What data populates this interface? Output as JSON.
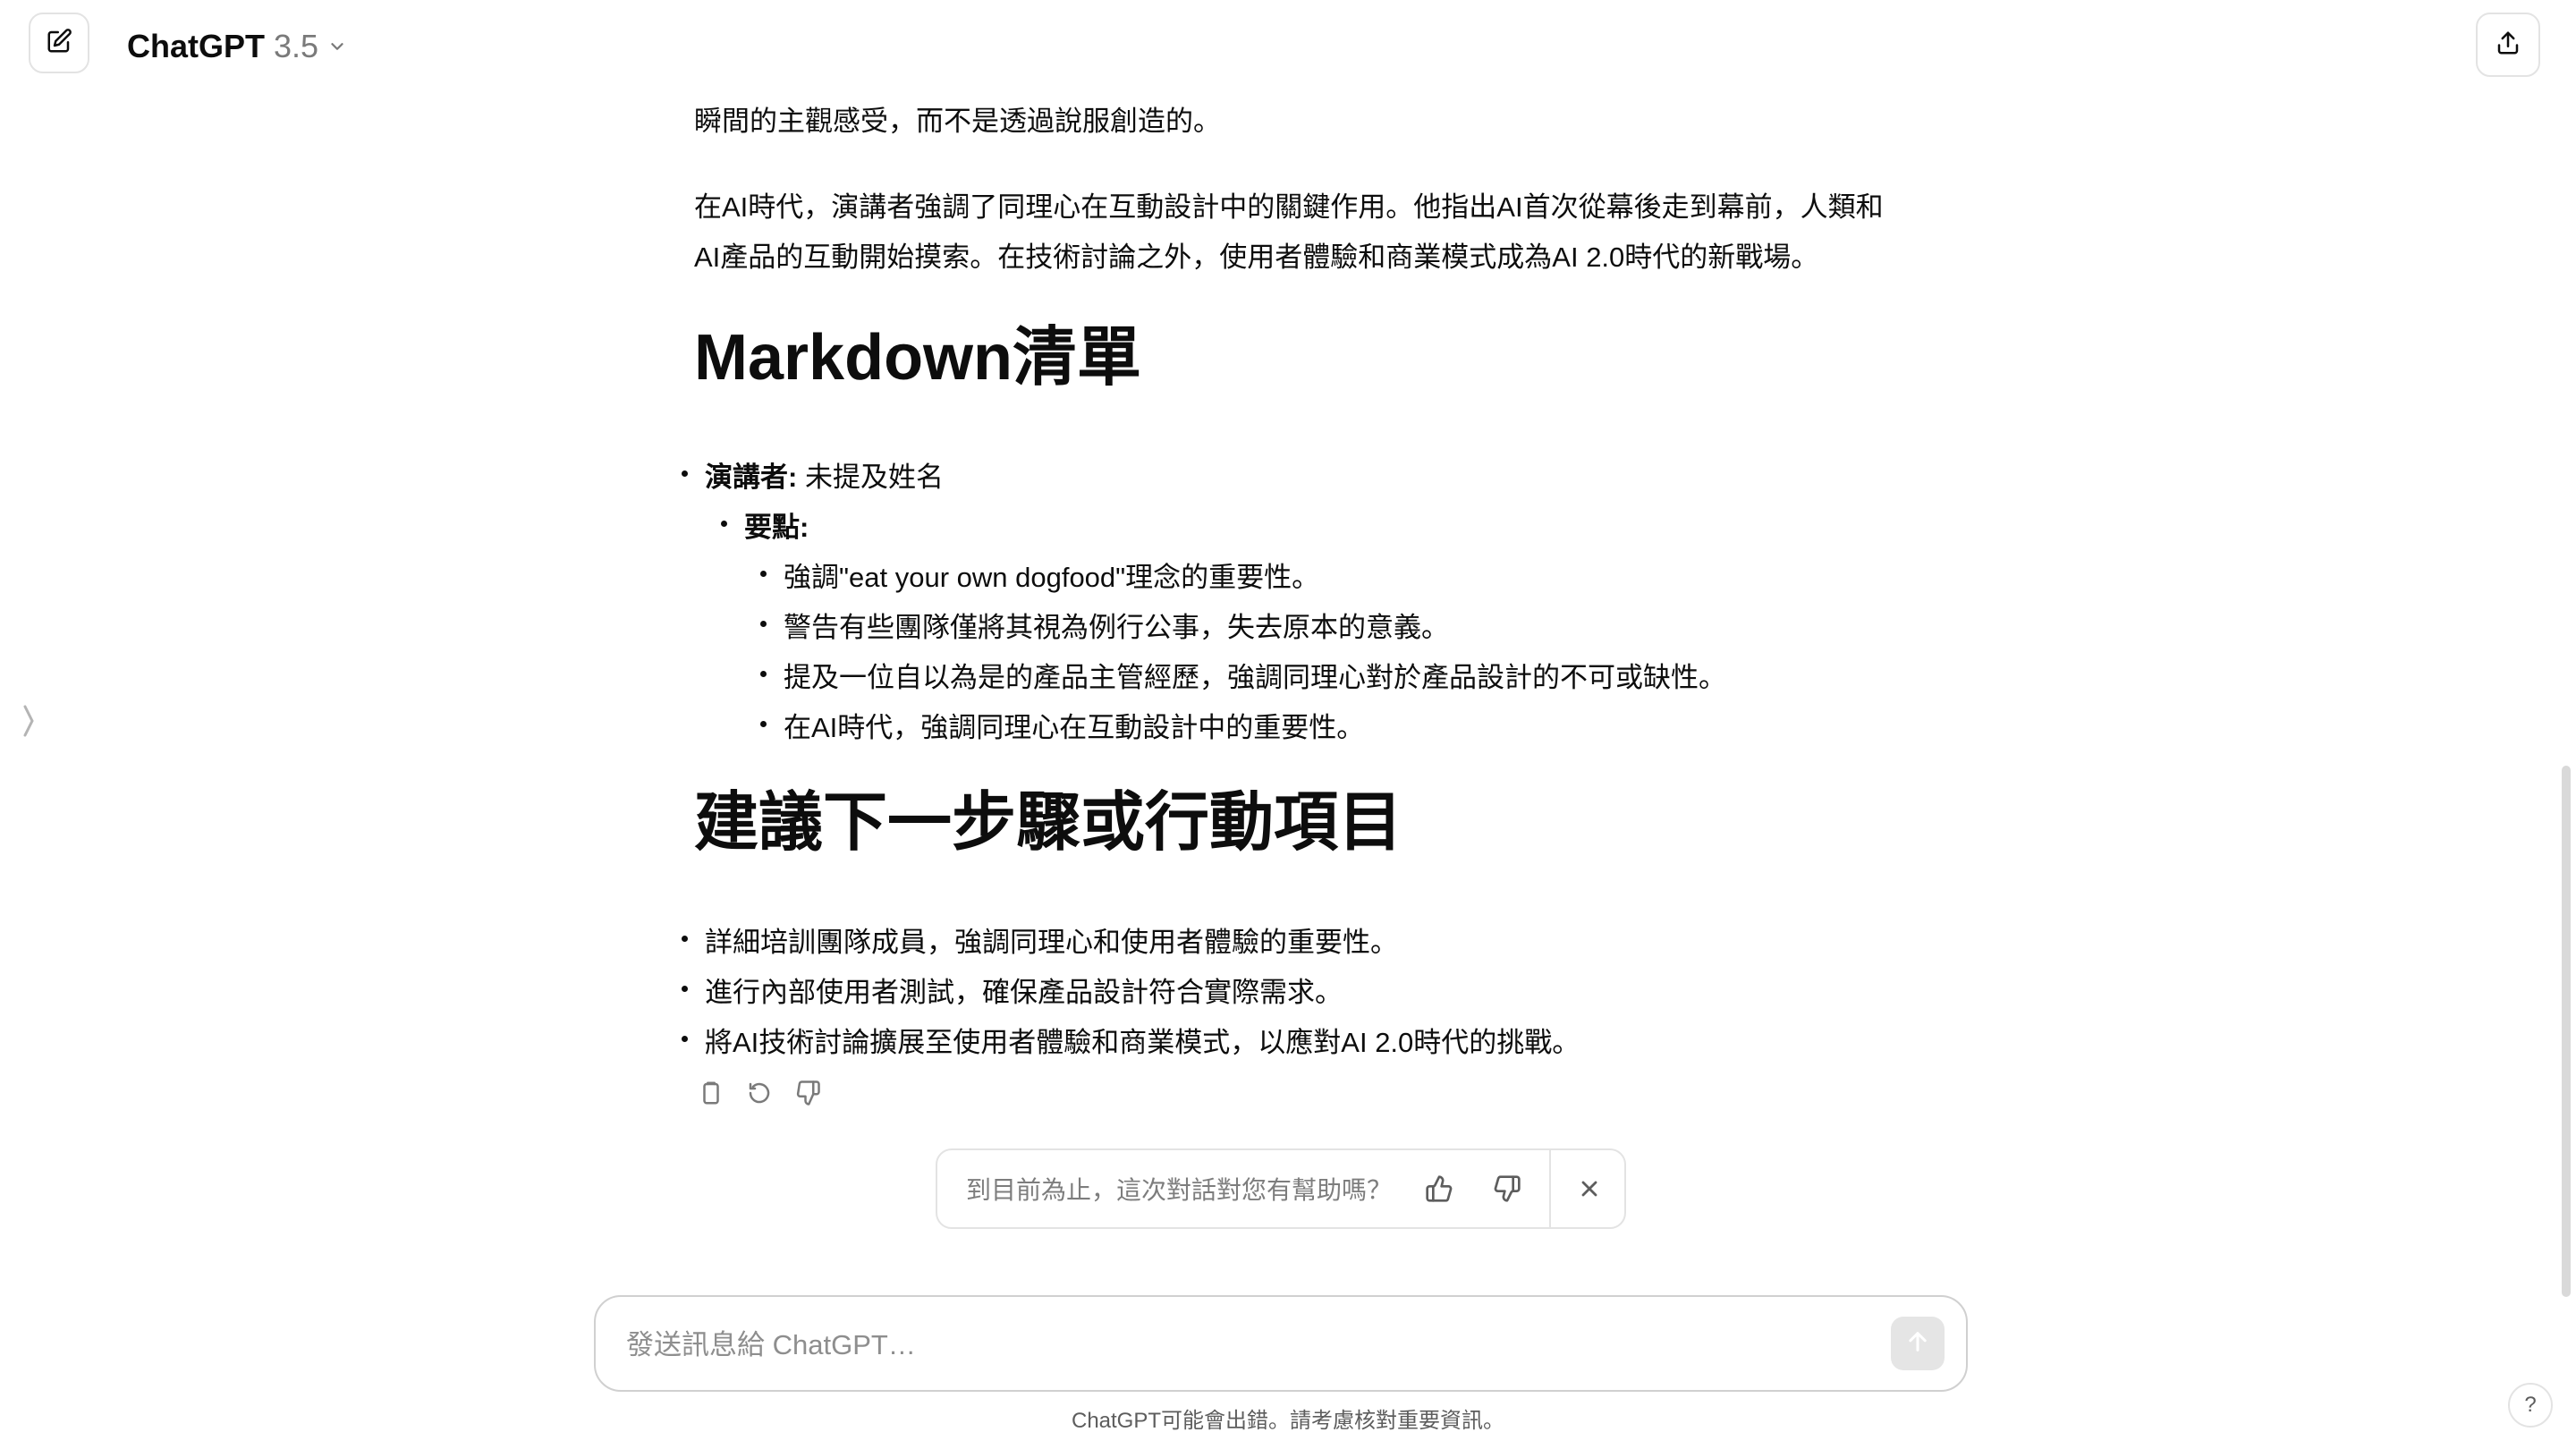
{
  "header": {
    "model_name": "ChatGPT",
    "model_version": "3.5",
    "icons": {
      "new_chat": "edit-icon",
      "model_dropdown": "chevron-down-icon",
      "share": "share-icon"
    }
  },
  "message": {
    "para1": "瞬間的主觀感受，而不是透過說服創造的。",
    "para2_line1": "在AI時代，演講者強調了同理心在互動設計中的關鍵作用。他指出AI首次從幕後走到幕前，人類和",
    "para2_line2": "AI產品的互動開始摸索。在技術討論之外，使用者體驗和商業模式成為AI 2.0時代的新戰場。",
    "heading1": "Markdown清單",
    "speaker_label": "演講者:",
    "speaker_value": " 未提及姓名",
    "points_label": "要點:",
    "points": [
      "強調\"eat your own dogfood\"理念的重要性。",
      "警告有些團隊僅將其視為例行公事，失去原本的意義。",
      "提及一位自以為是的產品主管經歷，強調同理心對於產品設計的不可或缺性。",
      "在AI時代，強調同理心在互動設計中的重要性。"
    ],
    "heading2": "建議下一步驟或行動項目",
    "next_steps": [
      "詳細培訓團隊成員，強調同理心和使用者體驗的重要性。",
      "進行內部使用者測試，確保產品設計符合實際需求。",
      "將AI技術討論擴展至使用者體驗和商業模式，以應對AI 2.0時代的挑戰。"
    ],
    "actions": [
      "copy-icon",
      "regenerate-icon",
      "thumbs-down-icon"
    ]
  },
  "feedback": {
    "question": "到目前為止，這次對話對您有幫助嗎？",
    "icons": [
      "thumbs-up-icon",
      "thumbs-down-icon",
      "close-icon"
    ]
  },
  "composer": {
    "placeholder": "發送訊息給 ChatGPT…",
    "value": "",
    "send_icon": "arrow-up-icon"
  },
  "disclaimer": "ChatGPT可能會出錯。請考慮核對重要資訊。",
  "help_label": "?",
  "sidebar_toggle_icon": "sidebar-toggle-icon"
}
